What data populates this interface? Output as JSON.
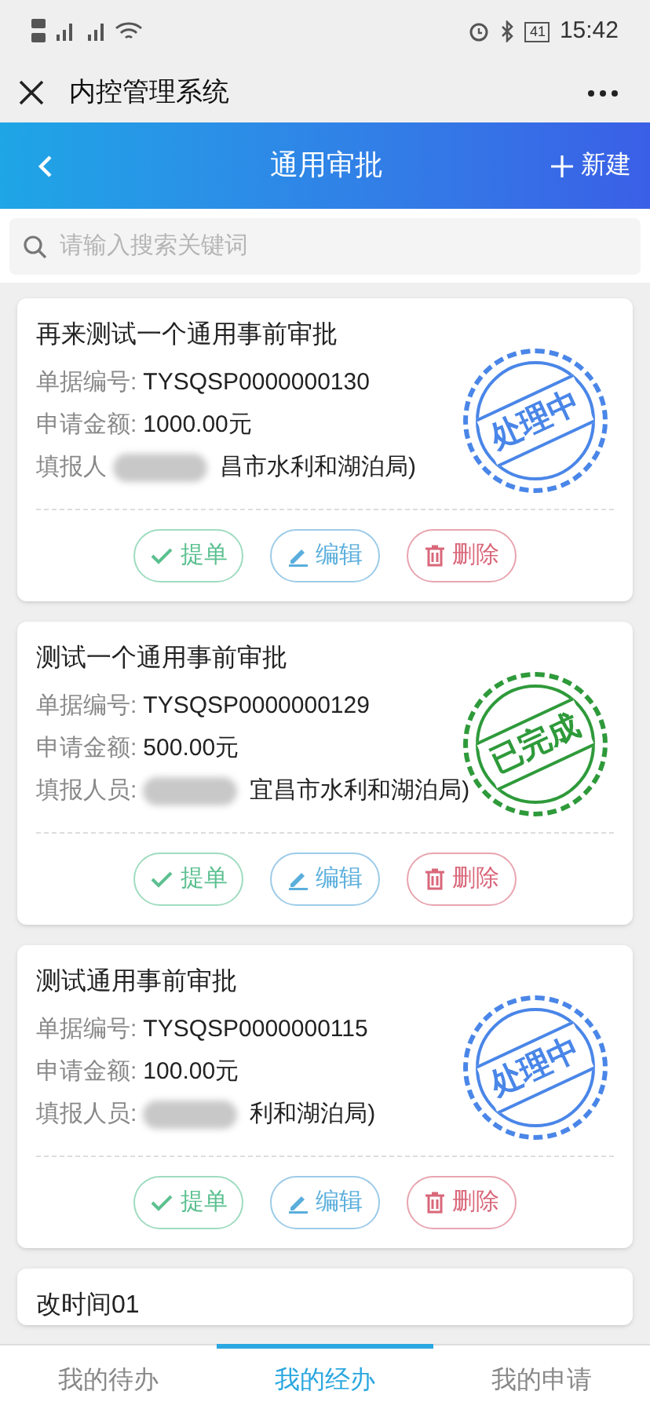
{
  "status_bar": {
    "time": "15:42",
    "battery": "41"
  },
  "app_bar": {
    "title": "内控管理系统"
  },
  "header": {
    "title": "通用审批",
    "action": "新建"
  },
  "search": {
    "placeholder": "请输入搜索关键词"
  },
  "cards": [
    {
      "title": "再来测试一个通用事前审批",
      "fields": [
        {
          "label": "单据编号:",
          "value": "TYSQSP0000000130"
        },
        {
          "label": "申请金额:",
          "value": "1000.00元"
        },
        {
          "label": "填报人",
          "value": "昌市水利和湖泊局)",
          "redacted": true
        }
      ],
      "stamp": {
        "kind": "processing",
        "text": "处理中"
      },
      "buttons": [
        {
          "kind": "submit",
          "label": "提单"
        },
        {
          "kind": "edit",
          "label": "编辑"
        },
        {
          "kind": "delete",
          "label": "删除"
        }
      ]
    },
    {
      "title": "测试一个通用事前审批",
      "fields": [
        {
          "label": "单据编号:",
          "value": "TYSQSP0000000129"
        },
        {
          "label": "申请金额:",
          "value": "500.00元"
        },
        {
          "label": "填报人员:",
          "value": "宜昌市水利和湖泊局)",
          "redacted": true
        }
      ],
      "stamp": {
        "kind": "done",
        "text": "已完成"
      },
      "buttons": [
        {
          "kind": "submit",
          "label": "提单"
        },
        {
          "kind": "edit",
          "label": "编辑"
        },
        {
          "kind": "delete",
          "label": "删除"
        }
      ]
    },
    {
      "title": "测试通用事前审批",
      "fields": [
        {
          "label": "单据编号:",
          "value": "TYSQSP0000000115"
        },
        {
          "label": "申请金额:",
          "value": "100.00元"
        },
        {
          "label": "填报人员:",
          "value": "利和湖泊局)",
          "redacted": true
        }
      ],
      "stamp": {
        "kind": "processing",
        "text": "处理中"
      },
      "buttons": [
        {
          "kind": "submit",
          "label": "提单"
        },
        {
          "kind": "edit",
          "label": "编辑"
        },
        {
          "kind": "delete",
          "label": "删除"
        }
      ]
    },
    {
      "title": "改时间01"
    }
  ],
  "tabs": [
    {
      "label": "我的待办",
      "selected": false
    },
    {
      "label": "我的经办",
      "selected": true
    },
    {
      "label": "我的申请",
      "selected": false
    }
  ]
}
